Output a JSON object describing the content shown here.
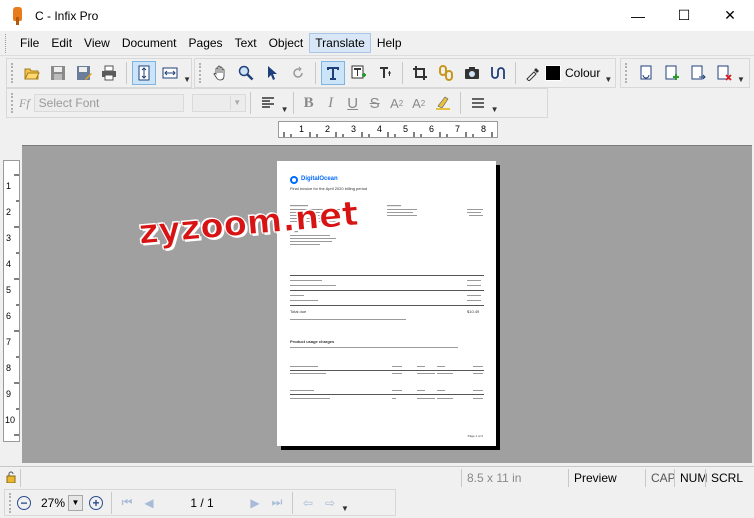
{
  "window": {
    "title": "C - Infix Pro",
    "minimize": "—",
    "maximize": "☐",
    "close": "✕"
  },
  "menu": [
    "File",
    "Edit",
    "View",
    "Document",
    "Pages",
    "Text",
    "Object",
    "Translate",
    "Help"
  ],
  "menu_active": "Translate",
  "toolbar": {
    "colour_label": "Colour"
  },
  "font_toolbar": {
    "font_placeholder": "Select Font",
    "font_glyph": "Ff",
    "bold": "B",
    "italic": "I",
    "underline": "U",
    "strike": "S",
    "superscript": "A",
    "subscript": "A",
    "sup_mark": "2",
    "sub_mark": "2"
  },
  "ruler": {
    "horizontal": [
      "1",
      "2",
      "3",
      "4",
      "5",
      "6",
      "7",
      "8"
    ],
    "vertical": [
      "1",
      "2",
      "3",
      "4",
      "5",
      "6",
      "7",
      "8",
      "9",
      "10"
    ]
  },
  "document": {
    "brand": "DigitalOcean",
    "heading": "Final invoice for the April 2020 billing period",
    "total_label": "Total due",
    "total_value": "$10.49",
    "section_title": "Product usage charges",
    "page_footer": "Page 1 of 2"
  },
  "watermark": "zyzoom.net",
  "status": {
    "page_size": "8.5 x 11 in",
    "mode": "Preview",
    "cap": "CAP",
    "num": "NUM",
    "scrl": "SCRL"
  },
  "nav": {
    "zoom_out": "−",
    "zoom_value": "27%",
    "zoom_in": "+",
    "page_counter": "1 / 1"
  }
}
